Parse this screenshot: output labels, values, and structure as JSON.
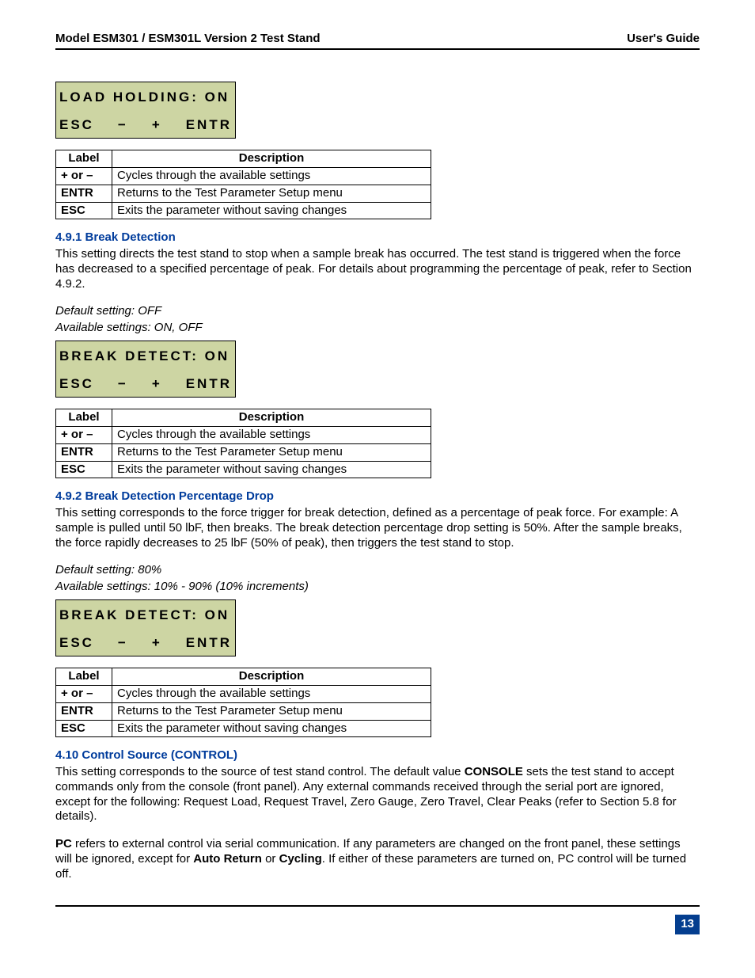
{
  "header": {
    "left": "Model ESM301 / ESM301L Version 2 Test Stand",
    "right": "User's Guide"
  },
  "lcd1": {
    "line1": "LOAD HOLDING: ON",
    "esc": "ESC",
    "minus": "−",
    "plus": "+",
    "entr": "ENTR"
  },
  "table_headers": {
    "label": "Label",
    "desc": "Description"
  },
  "table_common": {
    "r1_label": "+ or –",
    "r1_desc": "Cycles through the available settings",
    "r2_label": "ENTR",
    "r2_desc": "Returns to the Test Parameter Setup menu",
    "r3_label": "ESC",
    "r3_desc": "Exits the parameter without saving changes"
  },
  "sec491": {
    "title": "4.9.1 Break Detection",
    "p1": "This setting directs the test stand to stop when a sample break has occurred. The test stand is triggered when the force has decreased to a specified percentage of peak. For details about programming the percentage of peak, refer to Section 4.9.2.",
    "def": "Default setting: OFF",
    "avail": "Available settings: ON, OFF"
  },
  "lcd2": {
    "line1": "BREAK DETECT: ON",
    "esc": "ESC",
    "minus": "−",
    "plus": "+",
    "entr": "ENTR"
  },
  "sec492": {
    "title": "4.9.2 Break Detection Percentage Drop",
    "p1": "This setting corresponds to the force trigger for break detection, defined as a percentage of peak force. For example: A sample is pulled until 50 lbF, then breaks. The break detection percentage drop setting is 50%. After the sample breaks, the force rapidly decreases to 25 lbF (50% of peak), then triggers the test stand to stop.",
    "def": "Default setting: 80%",
    "avail": "Available settings: 10% - 90% (10% increments)"
  },
  "lcd3": {
    "line1": "BREAK DETECT: ON",
    "esc": "ESC",
    "minus": "−",
    "plus": "+",
    "entr": "ENTR"
  },
  "sec410": {
    "title": "4.10 Control Source (CONTROL)",
    "p1a": "This setting corresponds to the source of test stand control. The default value ",
    "p1b": "CONSOLE",
    "p1c": " sets the test stand to accept commands only from the console (front panel). Any external commands received through the serial port are ignored, except for the following: Request Load, Request Travel, Zero Gauge, Zero Travel, Clear Peaks (refer to Section 5.8 for details).",
    "p2a": "PC",
    "p2b": " refers to external control via serial communication. If any parameters are changed on the front panel, these settings will be ignored, except for ",
    "p2c": "Auto Return",
    "p2d": " or ",
    "p2e": "Cycling",
    "p2f": ". If either of these parameters are turned on, PC control will be turned off."
  },
  "page_number": "13"
}
